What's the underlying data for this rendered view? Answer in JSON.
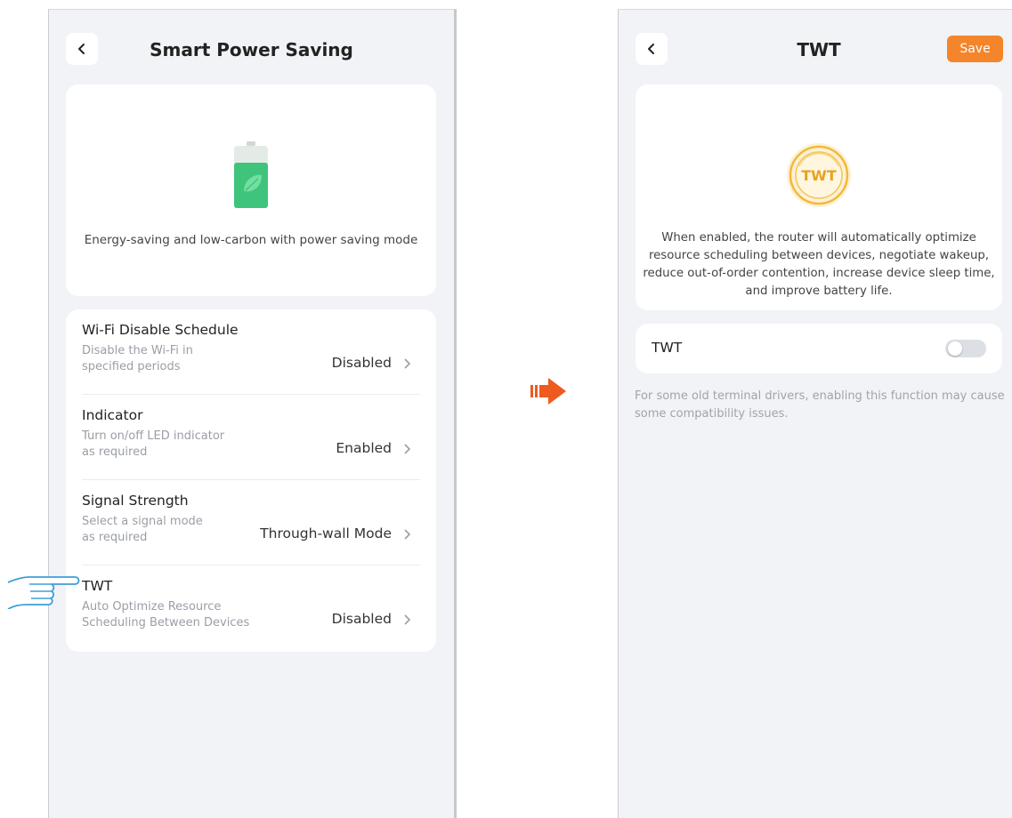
{
  "left_screen": {
    "title": "Smart Power Saving",
    "hero_text": "Energy-saving and low-carbon with power saving mode",
    "items": [
      {
        "title": "Wi-Fi Disable Schedule",
        "sub1": "Disable the Wi-Fi in",
        "sub2": "specified periods",
        "value": "Disabled"
      },
      {
        "title": "Indicator",
        "sub1": "Turn on/off LED indicator",
        "sub2": "as required",
        "value": "Enabled"
      },
      {
        "title": "Signal Strength",
        "sub1": "Select a signal mode",
        "sub2": "as required",
        "value": "Through-wall Mode"
      },
      {
        "title": "TWT",
        "sub1": "Auto Optimize Resource",
        "sub2": "Scheduling Between Devices",
        "value": "Disabled"
      }
    ]
  },
  "right_screen": {
    "title": "TWT",
    "save_label": "Save",
    "badge_text": "TWT",
    "description_lines": [
      "When enabled, the router will automatically optimize",
      "resource scheduling between devices, negotiate wakeup,",
      "reduce out-of-order contention, increase device sleep time,",
      "and improve battery life."
    ],
    "toggle_label": "TWT",
    "toggle_on": false,
    "note_lines": [
      "For some old terminal drivers, enabling this function may cause",
      "some compatibility issues."
    ]
  },
  "colors": {
    "accent": "#f4852a",
    "battery_green": "#3fc47b",
    "background": "#f1f3f7"
  },
  "icons": [
    "back-chevron-icon",
    "battery-leaf-icon",
    "chevron-right-icon",
    "pointing-hand-icon",
    "arrow-right-icon",
    "twt-badge-icon"
  ]
}
